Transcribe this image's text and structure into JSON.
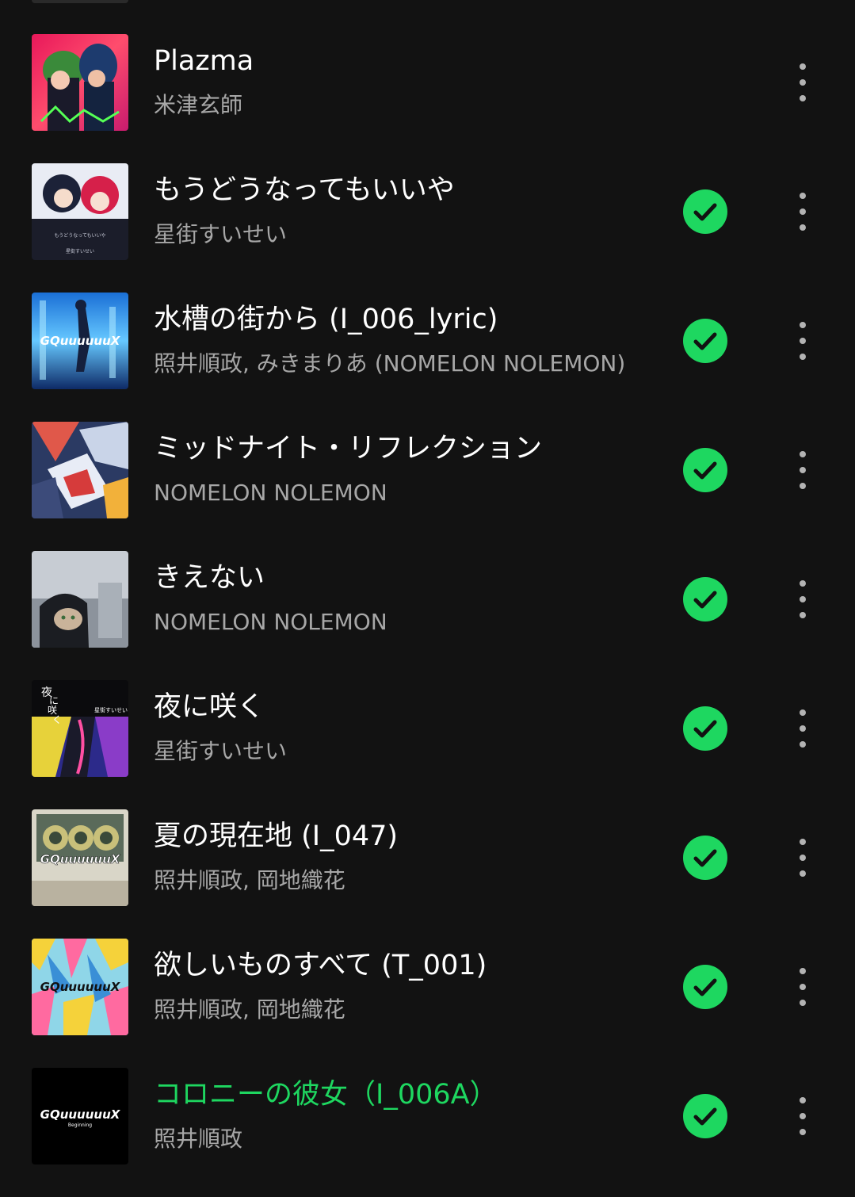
{
  "tracks": [
    {
      "title": "Plazma",
      "artist": "米津玄師",
      "downloaded": false,
      "playing": false,
      "cover_icon": "album-art-plazma"
    },
    {
      "title": "もうどうなってもいいや",
      "artist": "星街すいせい",
      "downloaded": true,
      "playing": false,
      "cover_icon": "album-art-moudounattemoiiya"
    },
    {
      "title": "水槽の街から (I_006_lyric)",
      "artist": "照井順政, みきまりあ (NOMELON NOLEMON)",
      "downloaded": true,
      "playing": false,
      "cover_icon": "album-art-gquuuuuux"
    },
    {
      "title": "ミッドナイト・リフレクション",
      "artist": "NOMELON NOLEMON",
      "downloaded": true,
      "playing": false,
      "cover_icon": "album-art-midnight-reflection"
    },
    {
      "title": "きえない",
      "artist": "NOMELON NOLEMON",
      "downloaded": true,
      "playing": false,
      "cover_icon": "album-art-kienai"
    },
    {
      "title": "夜に咲く",
      "artist": "星街すいせい",
      "downloaded": true,
      "playing": false,
      "cover_icon": "album-art-yoru-ni-saku"
    },
    {
      "title": "夏の現在地 (I_047)",
      "artist": "照井順政, 岡地織花",
      "downloaded": true,
      "playing": false,
      "cover_icon": "album-art-gquuuuuux"
    },
    {
      "title": "欲しいものすべて (T_001)",
      "artist": "照井順政, 岡地織花",
      "downloaded": true,
      "playing": false,
      "cover_icon": "album-art-gquuuuuux"
    },
    {
      "title": "コロニーの彼女（I_006A）",
      "artist": "照井順政",
      "downloaded": true,
      "playing": true,
      "cover_icon": "album-art-gquuuuuux-beginning"
    }
  ],
  "cover_labels": {
    "gquuuuuux": "GQuuuuuuX",
    "beginning": "Beginning",
    "yoru_ni_saku_vertical": [
      "夜",
      "に",
      "咲",
      "く"
    ],
    "yoru_ni_saku_artist": "星街すいせい",
    "mou_small_title": "もうどうなってもいいや",
    "mou_small_artist": "星街すいせい"
  },
  "colors": {
    "background": "#121212",
    "accent_green": "#1ed760",
    "title_text": "#ffffff",
    "artist_text": "#a7a7a7",
    "more_dots": "#b3b3b3"
  }
}
